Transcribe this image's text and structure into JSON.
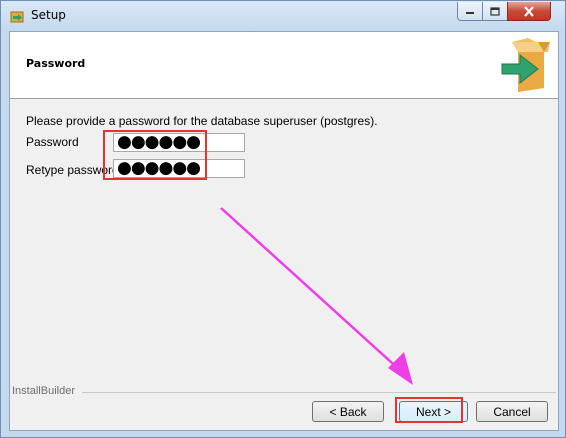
{
  "window": {
    "title": "Setup"
  },
  "header": {
    "title": "Password"
  },
  "form": {
    "intro": "Please provide a password for the database superuser (postgres).",
    "password_label": "Password",
    "password_value": "●●●●●●",
    "retype_label": "Retype password",
    "retype_value": "●●●●●●"
  },
  "footer": {
    "brand": "InstallBuilder",
    "back_label": "< Back",
    "next_label": "Next >",
    "cancel_label": "Cancel"
  },
  "colors": {
    "highlight": "#e53333",
    "arrow": "#ee3ee6"
  }
}
